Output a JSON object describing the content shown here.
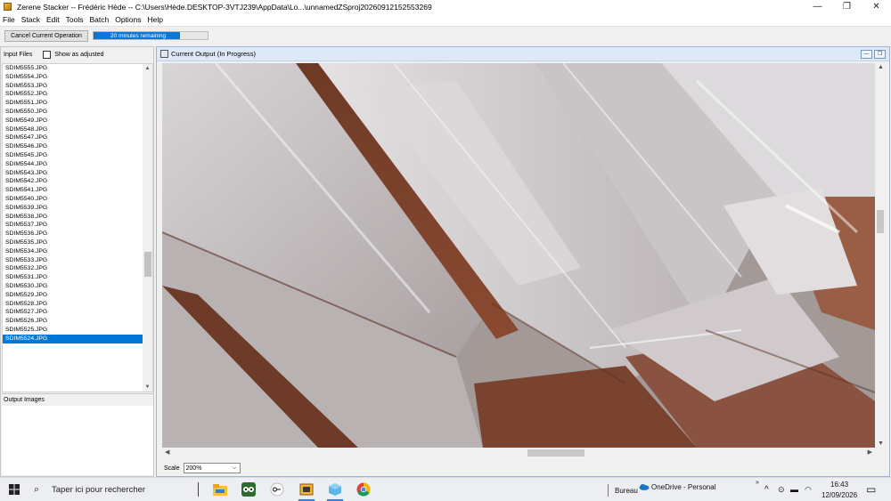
{
  "window": {
    "title": "Zerene Stacker -- Frédéric Hède -- C:\\Users\\Hède.DESKTOP-3VTJ239\\AppData\\Lo...\\unnamedZSproj20260912152553269",
    "minimize": "—",
    "maximize": "❐",
    "close": "✕"
  },
  "menu": [
    "File",
    "Stack",
    "Edit",
    "Tools",
    "Batch",
    "Options",
    "Help"
  ],
  "toolbar": {
    "cancel_label": "Cancel Current Operation",
    "progress_text": "20 minutes remaining",
    "progress_fraction": 0.76
  },
  "input_files": {
    "header": "Input Files",
    "show_adjusted_label": "Show as adjusted",
    "files": [
      "SDIM5555.JPG",
      "SDIM5554.JPG",
      "SDIM5553.JPG",
      "SDIM5552.JPG",
      "SDIM5551.JPG",
      "SDIM5550.JPG",
      "SDIM5549.JPG",
      "SDIM5548.JPG",
      "SDIM5547.JPG",
      "SDIM5546.JPG",
      "SDIM5545.JPG",
      "SDIM5544.JPG",
      "SDIM5543.JPG",
      "SDIM5542.JPG",
      "SDIM5541.JPG",
      "SDIM5540.JPG",
      "SDIM5539.JPG",
      "SDIM5538.JPG",
      "SDIM5537.JPG",
      "SDIM5536.JPG",
      "SDIM5535.JPG",
      "SDIM5534.JPG",
      "SDIM5533.JPG",
      "SDIM5532.JPG",
      "SDIM5531.JPG",
      "SDIM5530.JPG",
      "SDIM5529.JPG",
      "SDIM5528.JPG",
      "SDIM5527.JPG",
      "SDIM5526.JPG",
      "SDIM5525.JPG",
      "SDIM5524.JPG"
    ],
    "selected_index": 31
  },
  "output_images": {
    "header": "Output Images"
  },
  "viewer": {
    "title": "Current Output (In Progress)",
    "scale_label": "Scale",
    "scale_value": "200%"
  },
  "taskbar": {
    "search_placeholder": "Taper ici pour rechercher",
    "bureau_label": "Bureau",
    "onedrive_label": "OneDrive - Personal",
    "time": "16:43",
    "date": "12/09/2026",
    "apps": [
      "file-explorer-icon",
      "tripadvisor-icon",
      "keepass-icon",
      "zerene-icon",
      "3d-box-icon",
      "chrome-icon"
    ]
  },
  "colors": {
    "accent": "#0078d7",
    "doc_title_bg": "#dde9f7"
  }
}
